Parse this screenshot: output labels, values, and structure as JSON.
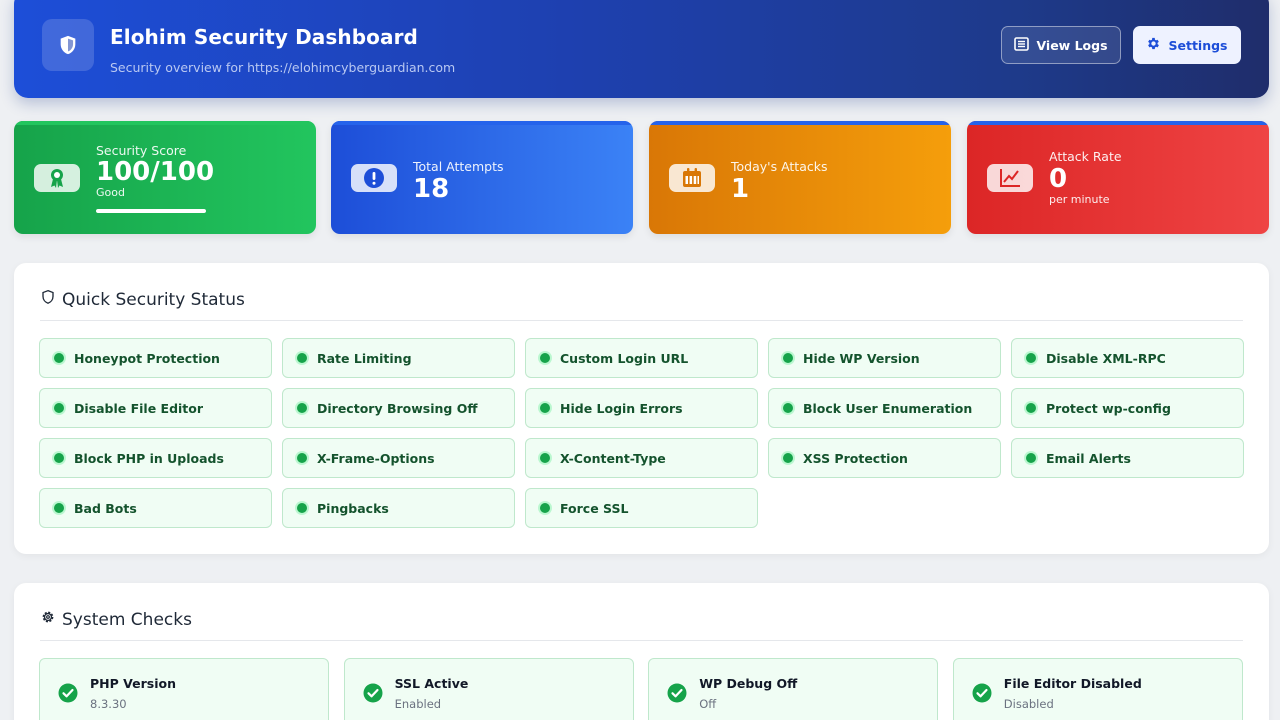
{
  "header": {
    "title": "Elohim Security Dashboard",
    "subtitle": "Security overview for https://elohimcyberguardian.com",
    "view_logs_label": "View Logs",
    "settings_label": "Settings"
  },
  "stats": {
    "score": {
      "label": "Security Score",
      "value": "100/100",
      "sub": "Good",
      "progress_percent": 100,
      "icon": "award-icon",
      "color": "#16a34a"
    },
    "attempts": {
      "label": "Total Attempts",
      "value": "18",
      "icon": "alert-circle-icon",
      "color": "#2563eb"
    },
    "today": {
      "label": "Today's Attacks",
      "value": "1",
      "icon": "calendar-icon",
      "color": "#f59e0b"
    },
    "rate": {
      "label": "Attack Rate",
      "value": "0",
      "sub": "per minute",
      "icon": "chart-line-icon",
      "color": "#ef4444"
    }
  },
  "quick_status": {
    "title": "Quick Security Status",
    "items": [
      "Honeypot Protection",
      "Rate Limiting",
      "Custom Login URL",
      "Hide WP Version",
      "Disable XML-RPC",
      "Disable File Editor",
      "Directory Browsing Off",
      "Hide Login Errors",
      "Block User Enumeration",
      "Protect wp-config",
      "Block PHP in Uploads",
      "X-Frame-Options",
      "X-Content-Type",
      "XSS Protection",
      "Email Alerts",
      "Bad Bots",
      "Pingbacks",
      "Force SSL"
    ]
  },
  "system_checks": {
    "title": "System Checks",
    "items": [
      {
        "name": "PHP Version",
        "value": "8.3.30"
      },
      {
        "name": "SSL Active",
        "value": "Enabled"
      },
      {
        "name": "WP Debug Off",
        "value": "Off"
      },
      {
        "name": "File Editor Disabled",
        "value": "Disabled"
      }
    ]
  },
  "colors": {
    "accent": "#1d4ed8",
    "ok": "#16a34a"
  }
}
